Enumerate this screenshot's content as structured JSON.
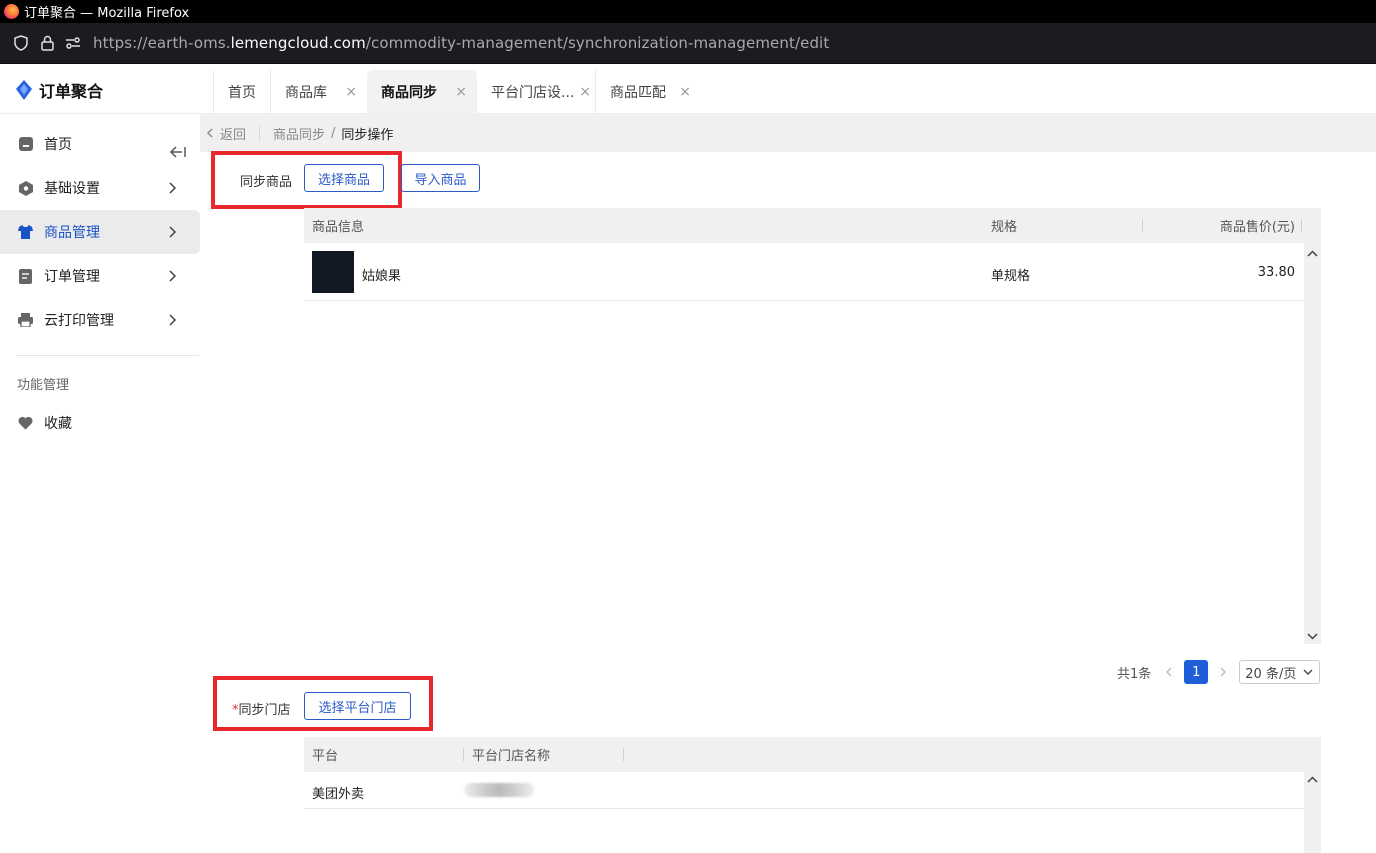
{
  "browser": {
    "window_title": "订单聚合 — Mozilla Firefox",
    "url_prefix": "https://earth-oms.",
    "url_domain": "lemengcloud.com",
    "url_path": "/commodity-management/synchronization-management/edit"
  },
  "app": {
    "brand": "订单聚合",
    "tabs": [
      {
        "label": "首页",
        "closable": false
      },
      {
        "label": "商品库",
        "closable": true
      },
      {
        "label": "商品同步",
        "closable": true,
        "active": true
      },
      {
        "label": "平台门店设...",
        "closable": true
      },
      {
        "label": "商品匹配",
        "closable": true
      }
    ],
    "close_glyph": "×"
  },
  "sidebar": {
    "items": [
      {
        "label": "首页",
        "icon": "home-icon"
      },
      {
        "label": "基础设置",
        "icon": "hexagon-icon"
      },
      {
        "label": "商品管理",
        "icon": "shirt-icon",
        "active": true
      },
      {
        "label": "订单管理",
        "icon": "document-icon"
      },
      {
        "label": "云打印管理",
        "icon": "printer-icon"
      }
    ],
    "section_title": "功能管理",
    "favorites_label": "收藏",
    "favorites_icon": "heart-icon",
    "active_color": "#1a52c7"
  },
  "breadcrumb": {
    "back_label": "返回",
    "parent": "商品同步",
    "separator": "/",
    "current": "同步操作"
  },
  "sync_products": {
    "label": "同步商品",
    "select_button": "选择商品",
    "import_button": "导入商品",
    "columns": [
      "商品信息",
      "规格",
      "商品售价(元)"
    ],
    "rows": [
      {
        "name": "姑娘果",
        "spec": "单规格",
        "price": "33.80"
      }
    ],
    "pagination": {
      "total": "共1条",
      "current_page": "1",
      "page_size": "20 条/页"
    }
  },
  "sync_stores": {
    "required_mark": "*",
    "label": "同步门店",
    "select_button": "选择平台门店",
    "columns": [
      "平台",
      "平台门店名称"
    ],
    "rows": [
      {
        "platform": "美团外卖"
      }
    ]
  },
  "colors": {
    "accent": "#2c5ac9",
    "highlight_box": "#e8282d",
    "page_active": "#1e5ed8"
  }
}
